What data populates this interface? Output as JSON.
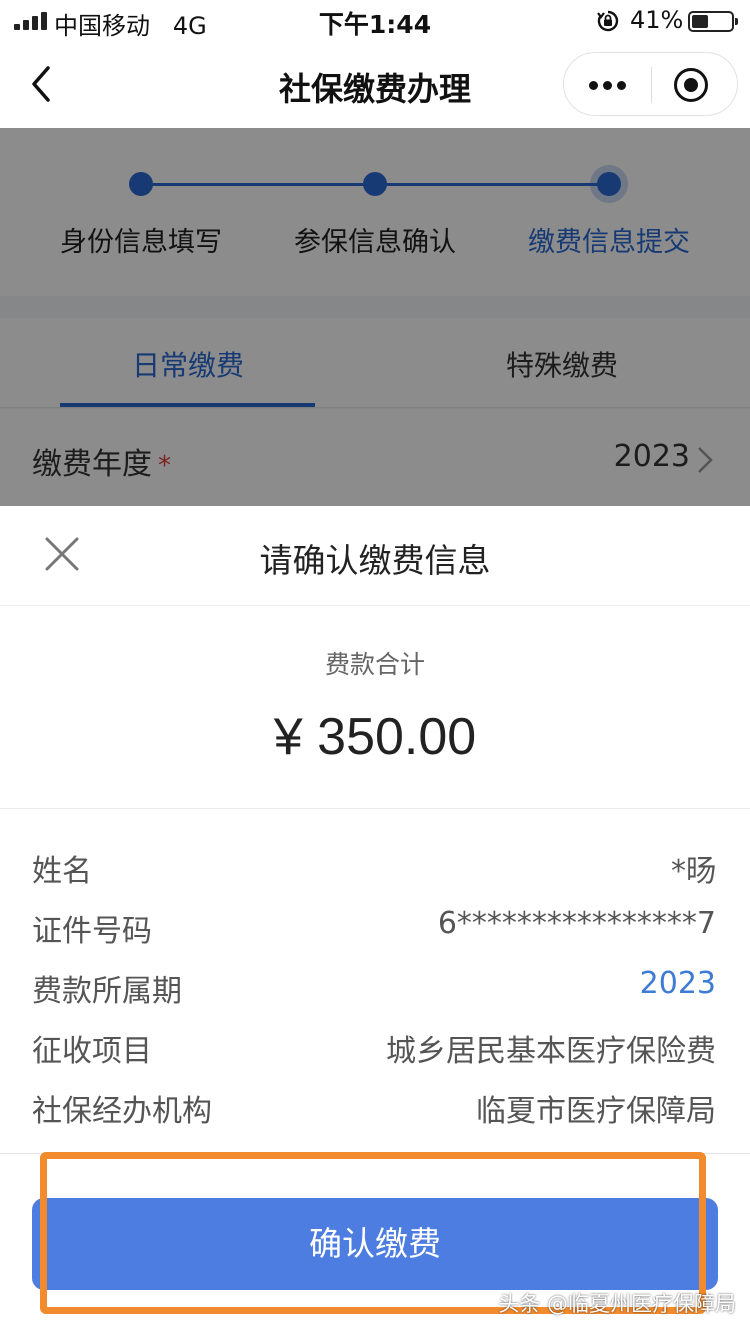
{
  "status_bar": {
    "carrier": "中国移动",
    "network": "4G",
    "time": "下午1:44",
    "battery_percent": "41%",
    "battery_level": 0.41
  },
  "nav": {
    "title": "社保缴费办理",
    "icons": [
      "back-icon",
      "more-icon",
      "close-mini-program-icon"
    ]
  },
  "steps": [
    {
      "label": "身份信息填写",
      "active": false
    },
    {
      "label": "参保信息确认",
      "active": false
    },
    {
      "label": "缴费信息提交",
      "active": true
    }
  ],
  "tabs": [
    {
      "label": "日常缴费",
      "active": true
    },
    {
      "label": "特殊缴费",
      "active": false
    }
  ],
  "form": {
    "year_label": "缴费年度",
    "required_mark": "*",
    "year_value": "2023"
  },
  "sheet": {
    "title": "请确认缴费信息",
    "total_label": "费款合计",
    "total_amount": "¥ 350.00",
    "details": [
      {
        "label": "姓名",
        "value": "*旸"
      },
      {
        "label": "证件号码",
        "value": "6****************7"
      },
      {
        "label": "费款所属期",
        "value": "2023"
      },
      {
        "label": "征收项目",
        "value": "城乡居民基本医疗保险费"
      },
      {
        "label": "社保经办机构",
        "value": "临夏市医疗保障局"
      }
    ],
    "confirm_label": "确认缴费"
  },
  "watermark": "头条 @临夏州医疗保障局",
  "colors": {
    "accent": "#2d6ad3",
    "button": "#4d7de0",
    "highlight": "#f28a2e",
    "required": "#e23b3b"
  }
}
